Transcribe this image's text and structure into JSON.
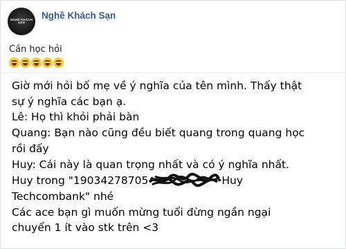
{
  "post": {
    "page_name": "Nghề Khách Sạn",
    "avatar_text": "NGHỀ KHÁCH SẠN",
    "caption": "Cần học hỏi",
    "emoji_count": 5,
    "emoji_icon": "laughing-crying-emoji"
  },
  "message": {
    "line1": "Giờ mới hỏi bố mẹ về ý nghĩa của tên mình. Thấy thật",
    "line2": "sự ý nghĩa các bạn ạ.",
    "line3": "Lê: Họ thì khỏi phải bàn",
    "line4": "Quang: Bạn nào cũng đều biết quang trong quang học",
    "line5": "rồi đấy",
    "line6": "Huy: Cái này là quan trọng nhất và có ý nghĩa nhất.",
    "line7_start": "Huy trong \"19034278705",
    "line7_end": "Huy",
    "line8": "Techcombank\" nhé",
    "line9": "Các ace bạn gì muốn mừng tuổi đừng ngần ngại",
    "line10": "chuyển 1 ít vào stk trên <3"
  },
  "colors": {
    "link": "#385898",
    "text": "#1c1e21",
    "border": "#dddfe2"
  }
}
